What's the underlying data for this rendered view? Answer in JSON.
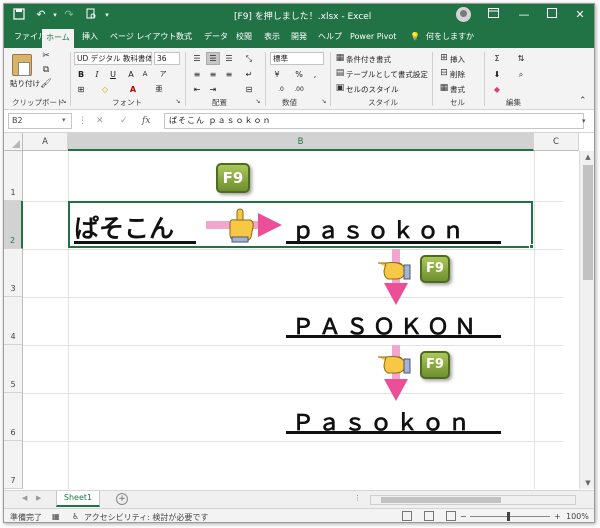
{
  "window": {
    "title": "[F9] を押しました！.xlsx  -  Excel",
    "controls": [
      "ribbon-display",
      "minimize",
      "maximize",
      "close"
    ]
  },
  "tabs": [
    "ファイル",
    "ホーム",
    "挿入",
    "ページ レイアウト",
    "数式",
    "データ",
    "校閲",
    "表示",
    "開発",
    "ヘルプ",
    "Power Pivot"
  ],
  "active_tab": "ホーム",
  "tell_me": "何をしますか",
  "ribbon": {
    "clipboard": {
      "label": "クリップボード",
      "paste": "貼り付け"
    },
    "font": {
      "label": "フォント",
      "name": "UD デジタル 教科書体",
      "size": "36"
    },
    "alignment": {
      "label": "配置"
    },
    "number": {
      "label": "数値",
      "format": "標準",
      "percent": "%",
      "comma": ","
    },
    "styles": {
      "label": "スタイル",
      "conditional": "条件付き書式",
      "table": "テーブルとして書式設定",
      "cell": "セルのスタイル"
    },
    "cells": {
      "label": "セル",
      "insert": "挿入",
      "delete": "削除",
      "format": "書式"
    },
    "editing": {
      "label": "編集"
    }
  },
  "formula_bar": {
    "name_box": "B2",
    "fx": "fx",
    "content": "ぱそこん    ｐａｓｏｋｏｎ"
  },
  "grid": {
    "columns": [
      "A",
      "B",
      "C"
    ],
    "rows": [
      "1",
      "2",
      "3",
      "4",
      "5",
      "6",
      "7"
    ],
    "selected_cell": "B2",
    "cells": {
      "b2_hiragana": "ぱそこん",
      "b2_result": "ｐａｓｏｋｏｎ",
      "b4": "ＰＡＳＯＫＯＮ",
      "b6": "Ｐａｓｏｋｏｎ"
    },
    "f9_key": "F9"
  },
  "sheet_tabs": [
    "Sheet1"
  ],
  "status": {
    "ready": "準備完了",
    "accessibility": "アクセシビリティ: 検討が必要です",
    "zoom": "100%"
  },
  "colors": {
    "excel_green": "#217346",
    "f9_green": "#8aaa3f",
    "arrow_pink": "#f06aa8",
    "hand_yellow": "#f6c845"
  }
}
